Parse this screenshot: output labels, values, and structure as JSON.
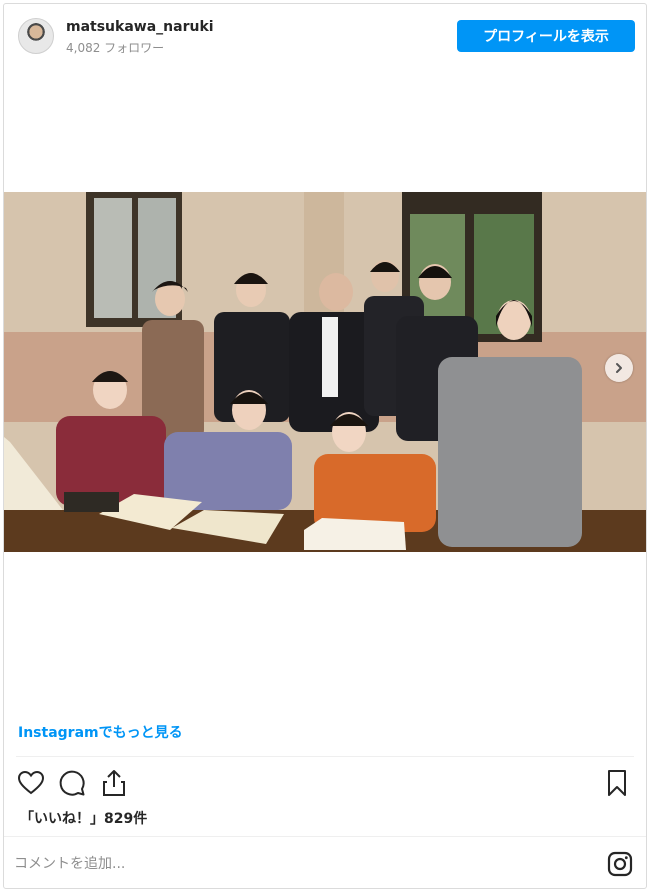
{
  "header": {
    "username": "matsukawa_naruki",
    "followers": "4,082 フォロワー",
    "profile_button": "プロフィールを表示"
  },
  "post": {
    "more_link": "Instagramでもっと見る",
    "likes": "「いいね！」829件",
    "comment_placeholder": "コメントを追加..."
  },
  "icons": [
    "avatar",
    "chevron-right-icon",
    "heart-icon",
    "comment-icon",
    "share-icon",
    "bookmark-icon",
    "instagram-icon"
  ],
  "colors": {
    "accent": "#0095f6",
    "text": "#262626",
    "muted": "#8e8e8e",
    "border": "#dbdbdb"
  }
}
